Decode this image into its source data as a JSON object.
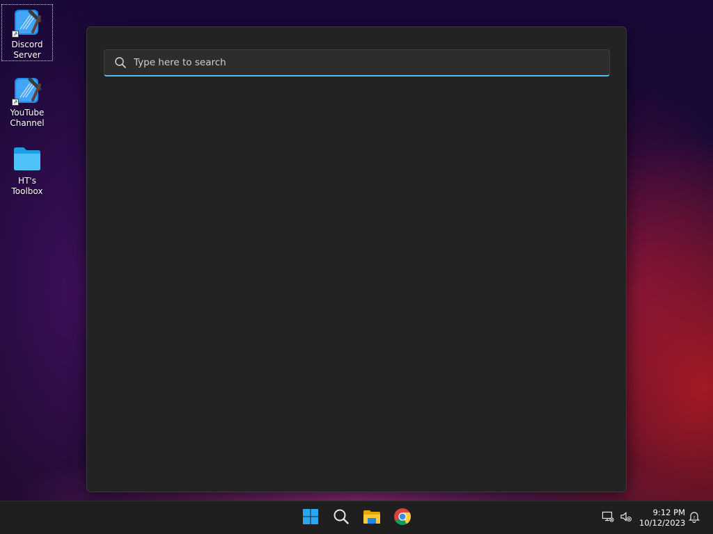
{
  "desktop": {
    "icons": [
      {
        "line1": "Discord",
        "line2": "Server",
        "kind": "shortcut"
      },
      {
        "line1": "YouTube",
        "line2": "Channel",
        "kind": "shortcut"
      },
      {
        "line1": "HT's Toolbox",
        "line2": "",
        "kind": "folder"
      }
    ]
  },
  "search": {
    "placeholder": "Type here to search",
    "value": ""
  },
  "taskbar": {
    "apps": [
      {
        "name": "Start",
        "icon": "windows-logo-icon"
      },
      {
        "name": "Search",
        "icon": "search-icon"
      },
      {
        "name": "File Explorer",
        "icon": "folder-icon"
      },
      {
        "name": "Google Chrome",
        "icon": "chrome-icon"
      }
    ],
    "tray": {
      "network_icon": "network-disconnected-icon",
      "volume_icon": "volume-muted-icon",
      "notification_icon": "notification-bell-icon"
    },
    "clock": {
      "time": "9:12 PM",
      "date": "10/12/2023"
    }
  },
  "colors": {
    "accent": "#4cc2ff",
    "panel": "#232323",
    "taskbar": "#1f1f1f"
  }
}
